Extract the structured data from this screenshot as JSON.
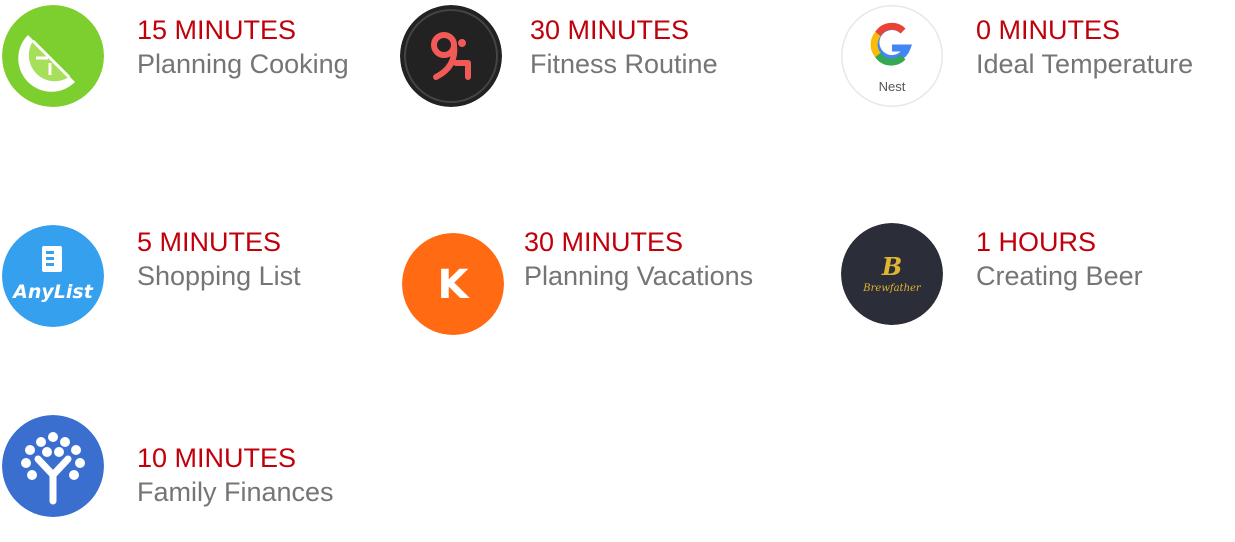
{
  "items": [
    {
      "time": "15 MINUTES",
      "label": "Planning Cooking",
      "icon": "lime-slice-icon",
      "color": "#7ccf2e"
    },
    {
      "time": "30 MINUTES",
      "label": "Fitness Routine",
      "icon": "fitness-figure-icon",
      "color": "#222222"
    },
    {
      "time": "0 MINUTES",
      "label": "Ideal Temperature",
      "icon": "google-nest-icon",
      "icon_text": "Nest",
      "color": "#ffffff"
    },
    {
      "time": "5 MINUTES",
      "label": "Shopping List",
      "icon": "anylist-icon",
      "icon_text": "AnyList",
      "color": "#35a0ee"
    },
    {
      "time": "30 MINUTES",
      "label": "Planning Vacations",
      "icon": "kayak-k-icon",
      "icon_text": "K",
      "color": "#ff6a13"
    },
    {
      "time": "1 HOURS",
      "label": "Creating Beer",
      "icon": "brewfather-icon",
      "icon_text": "Brewfather",
      "icon_letter": "B",
      "color": "#2b2d38"
    },
    {
      "time": "10 MINUTES",
      "label": "Family Finances",
      "icon": "tree-y-icon",
      "color": "#3a6fd0"
    }
  ],
  "colors": {
    "time_text": "#c0000b",
    "label_text": "#757575"
  }
}
